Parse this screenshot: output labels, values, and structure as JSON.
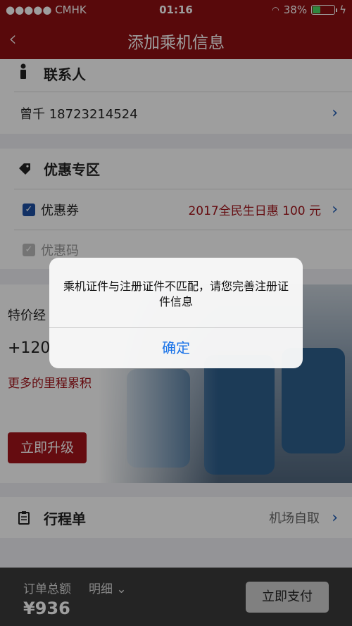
{
  "status_bar": {
    "carrier": "●●●●● CMHK",
    "time": "01:16",
    "battery": "38%",
    "battery_level": 0.38
  },
  "nav": {
    "title": "添加乘机信息",
    "back_glyph": "‹"
  },
  "contact": {
    "section_title": "联系人",
    "person": "曾千 18723214524"
  },
  "discount": {
    "section_title": "优惠专区",
    "coupon_label": "优惠券",
    "coupon_value": "2017全民生日惠 100 元",
    "code_label": "优惠码"
  },
  "upgrade": {
    "line1": "特价经",
    "line2": "+120",
    "link": "更多的里程累积",
    "button": "立即升级"
  },
  "itinerary": {
    "label": "行程单",
    "value": "机场自取"
  },
  "bottom": {
    "total_label": "订单总额",
    "detail_label": "明细",
    "total": "¥936",
    "pay_button": "立即支付"
  },
  "alert": {
    "message": "乘机证件与注册证件不匹配，请您完善注册证件信息",
    "confirm": "确定"
  },
  "colors": {
    "brand_red": "#8f0f12",
    "link_blue": "#1a73e8",
    "accent_red": "#a3141b"
  }
}
